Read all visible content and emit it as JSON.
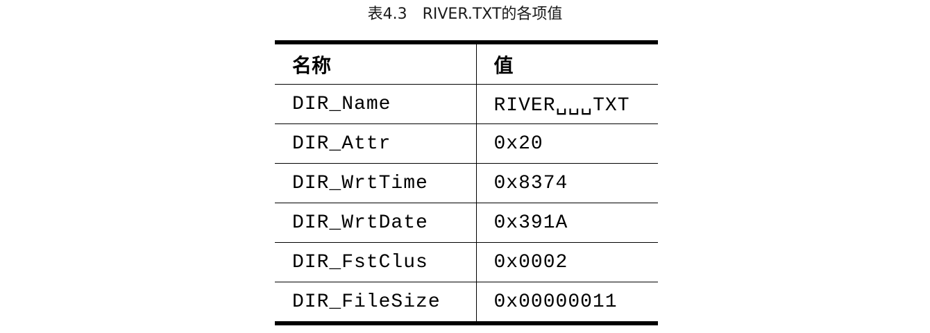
{
  "caption": "表4.3　RIVER.TXT的各项值",
  "table": {
    "headers": [
      "名称",
      "值"
    ],
    "rows": [
      {
        "name": "DIR_Name",
        "value": "RIVER␣␣␣TXT"
      },
      {
        "name": "DIR_Attr",
        "value": "0x20"
      },
      {
        "name": "DIR_WrtTime",
        "value": "0x8374"
      },
      {
        "name": "DIR_WrtDate",
        "value": "0x391A"
      },
      {
        "name": "DIR_FstClus",
        "value": "0x0002"
      },
      {
        "name": "DIR_FileSize",
        "value": "0x00000011"
      }
    ]
  }
}
